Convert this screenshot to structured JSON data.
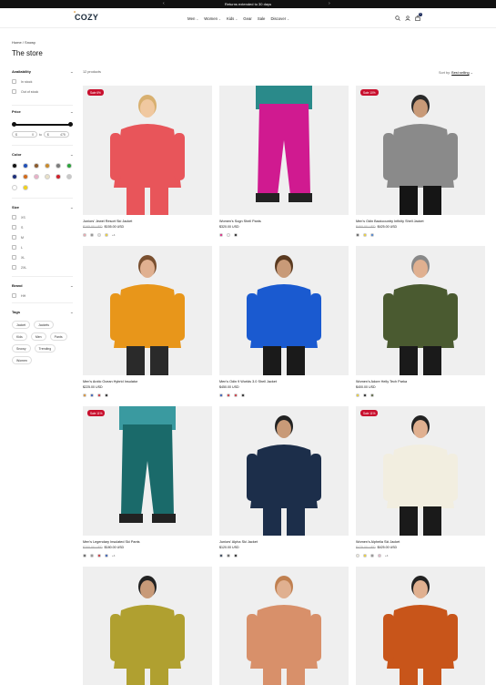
{
  "announcement": {
    "text": "Returns extended to 30 days",
    "prev_icon": "chevron-left-icon",
    "next_icon": "chevron-right-icon"
  },
  "brand": {
    "logo": "COZY"
  },
  "nav": [
    {
      "label": "Men",
      "dropdown": true
    },
    {
      "label": "Women",
      "dropdown": true
    },
    {
      "label": "Kids",
      "dropdown": true
    },
    {
      "label": "Gear",
      "dropdown": false
    },
    {
      "label": "Sale",
      "dropdown": false
    },
    {
      "label": "Discover",
      "dropdown": true
    }
  ],
  "header_icons": {
    "search": "search-icon",
    "account": "user-icon",
    "cart": "bag-icon",
    "cart_count": "1"
  },
  "breadcrumb": {
    "home": "Home",
    "sep": "/",
    "current": "Snowy"
  },
  "page_title": "The store",
  "filters": {
    "availability": {
      "title": "Availability",
      "options": [
        "In stock",
        "Out of stock"
      ]
    },
    "price": {
      "title": "Price",
      "from_currency": "$",
      "from_value": "0",
      "to_label": "to",
      "to_currency": "$",
      "to_value": "475",
      "range_min": 0,
      "range_max": 475
    },
    "color": {
      "title": "Color",
      "swatches": [
        "#111111",
        "#1f4fb8",
        "#8b5a2b",
        "#c98a2b",
        "#7a7a7a",
        "#2aa33a",
        "#1c2e7a",
        "#d36a1a",
        "#e8b0c8",
        "#e8e0c8",
        "#d0202a",
        "#c8c8c8",
        "#ffffff",
        "#f2d21a"
      ]
    },
    "size": {
      "title": "Size",
      "options": [
        "XS",
        "S",
        "M",
        "L",
        "XL",
        "2XL"
      ]
    },
    "brand": {
      "title": "Brand",
      "options": [
        "HH"
      ]
    },
    "tags": {
      "title": "Tags",
      "items": [
        "Jacket",
        "Jackets",
        "Kids",
        "Men",
        "Pants",
        "Snowy",
        "Trending",
        "Women"
      ]
    }
  },
  "toolbar": {
    "count": "12 products",
    "sort_label": "Sort by:",
    "sort_value": "Best selling"
  },
  "products": [
    {
      "name": "Juniors' Jewel Resort Ski Jacket",
      "old_price": "$165.00 USD",
      "price": "$155.00 USD",
      "sale": "Sale 6%",
      "colors": [
        "#f0a0a8",
        "#888888",
        "#e8e8e8",
        "#f2d21a"
      ],
      "more": "+4"
    },
    {
      "name": "Women's Sogn Shell Pants",
      "old_price": "",
      "price": "$320.00 USD",
      "sale": "",
      "colors": [
        "#e0107a",
        "#ffffff",
        "#111111"
      ],
      "more": ""
    },
    {
      "name": "Men's Odin Backcountry Infinity Shell Jacket",
      "old_price": "$460.00 USD",
      "price": "$425.00 USD",
      "sale": "Sale 10%",
      "colors": [
        "#555555",
        "#f2d21a",
        "#3a7ad0"
      ],
      "more": ""
    },
    {
      "name": "Men's Arctic Ocean Hybrid Insulator",
      "old_price": "",
      "price": "$225.00 USD",
      "sale": "",
      "colors": [
        "#e08a1a",
        "#1f4fb8",
        "#d0202a",
        "#111111"
      ],
      "more": ""
    },
    {
      "name": "Men's Odin 9 Worlds 3.0 Shell Jacket",
      "old_price": "",
      "price": "$450.00 USD",
      "sale": "",
      "colors": [
        "#1f4fb8",
        "#d0202a",
        "#d0202a",
        "#111111"
      ],
      "more": ""
    },
    {
      "name": "Women's Adore Helly Tech Parka",
      "old_price": "",
      "price": "$400.00 USD",
      "sale": "",
      "colors": [
        "#f2d21a",
        "#111111",
        "#4a5a30"
      ],
      "more": ""
    },
    {
      "name": "Men's Legendary Insulated Ski Pants",
      "old_price": "$200.00 USD",
      "price": "$180.00 USD",
      "sale": "Sale 11%",
      "colors": [
        "#555555",
        "#888888",
        "#d0202a",
        "#1f4fb8"
      ],
      "more": "+4"
    },
    {
      "name": "Juniors' Alpha Ski Jacket",
      "old_price": "",
      "price": "$120.00 USD",
      "sale": "",
      "colors": [
        "#1c2e4a",
        "#555555",
        "#111111"
      ],
      "more": ""
    },
    {
      "name": "Women's Alphelia Ski Jacket",
      "old_price": "$475.00 USD",
      "price": "$425.00 USD",
      "sale": "Sale 11%",
      "colors": [
        "#f5f0e0",
        "#f2d21a",
        "#888888",
        "#e8b0c8"
      ],
      "more": "+4"
    },
    {
      "name": "",
      "old_price": "",
      "price": "",
      "sale": "",
      "colors": [],
      "more": ""
    },
    {
      "name": "",
      "old_price": "",
      "price": "",
      "sale": "",
      "colors": [],
      "more": ""
    },
    {
      "name": "",
      "old_price": "",
      "price": "",
      "sale": "",
      "colors": [],
      "more": ""
    }
  ]
}
